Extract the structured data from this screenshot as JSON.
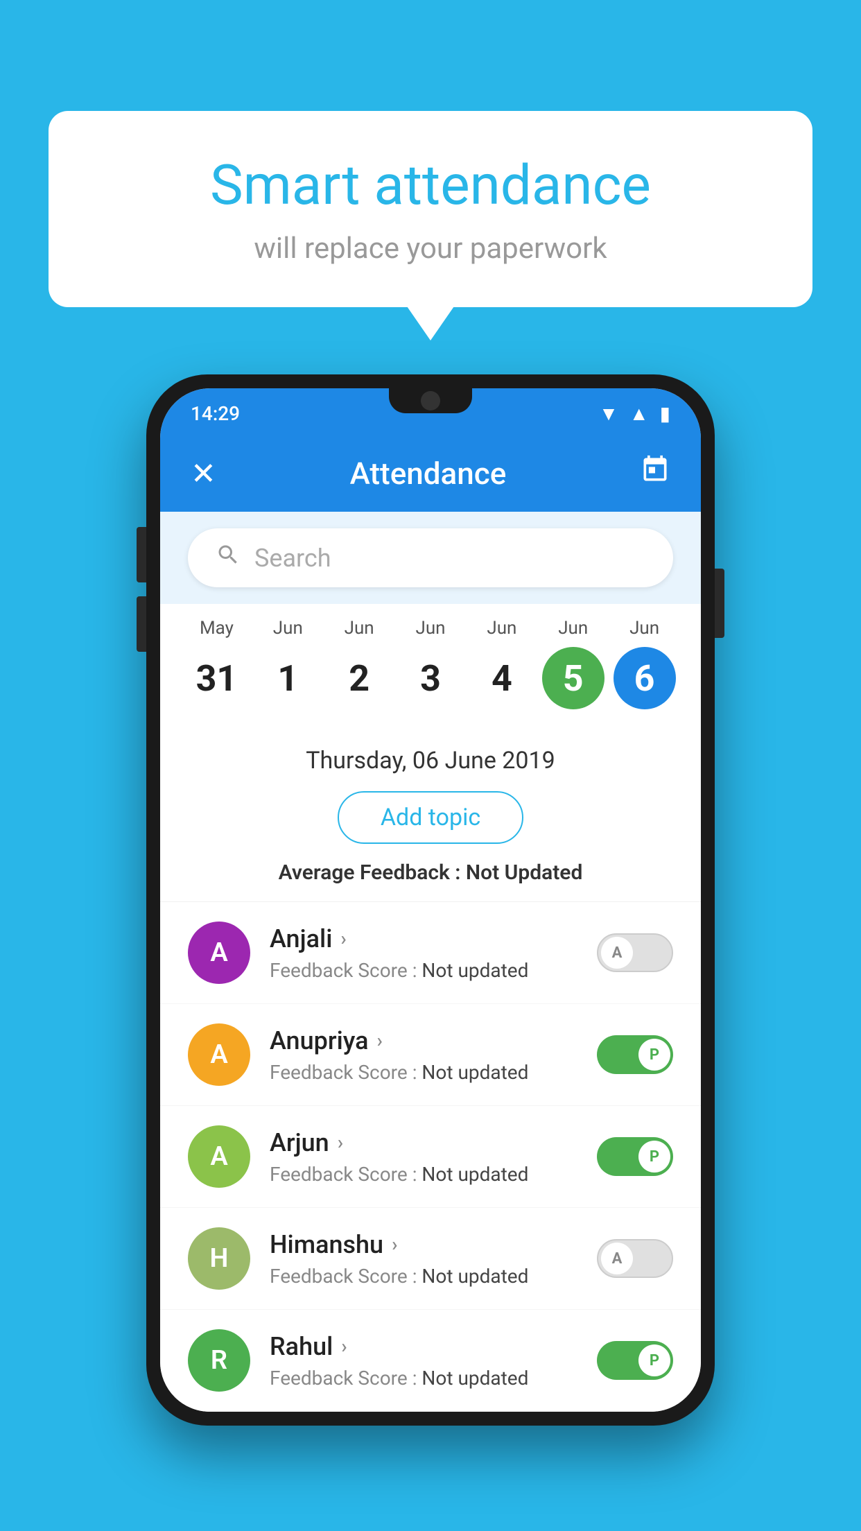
{
  "background_color": "#29b6e8",
  "speech_bubble": {
    "title": "Smart attendance",
    "subtitle": "will replace your paperwork"
  },
  "status_bar": {
    "time": "14:29",
    "icons": [
      "wifi",
      "signal",
      "battery"
    ]
  },
  "app_bar": {
    "title": "Attendance",
    "close_label": "✕",
    "calendar_icon": "📅"
  },
  "search": {
    "placeholder": "Search"
  },
  "calendar": {
    "days": [
      {
        "month": "May",
        "date": "31",
        "style": "normal"
      },
      {
        "month": "Jun",
        "date": "1",
        "style": "normal"
      },
      {
        "month": "Jun",
        "date": "2",
        "style": "normal"
      },
      {
        "month": "Jun",
        "date": "3",
        "style": "normal"
      },
      {
        "month": "Jun",
        "date": "4",
        "style": "normal"
      },
      {
        "month": "Jun",
        "date": "5",
        "style": "today"
      },
      {
        "month": "Jun",
        "date": "6",
        "style": "selected"
      }
    ]
  },
  "date_info": {
    "label": "Thursday, 06 June 2019",
    "add_topic_label": "Add topic",
    "avg_feedback_label": "Average Feedback : ",
    "avg_feedback_value": "Not Updated"
  },
  "students": [
    {
      "name": "Anjali",
      "avatar_letter": "A",
      "avatar_color": "#9c27b0",
      "feedback_label": "Feedback Score : ",
      "feedback_value": "Not updated",
      "toggle_state": "off",
      "toggle_label": "A"
    },
    {
      "name": "Anupriya",
      "avatar_letter": "A",
      "avatar_color": "#f5a623",
      "feedback_label": "Feedback Score : ",
      "feedback_value": "Not updated",
      "toggle_state": "on",
      "toggle_label": "P"
    },
    {
      "name": "Arjun",
      "avatar_letter": "A",
      "avatar_color": "#8bc34a",
      "feedback_label": "Feedback Score : ",
      "feedback_value": "Not updated",
      "toggle_state": "on",
      "toggle_label": "P"
    },
    {
      "name": "Himanshu",
      "avatar_letter": "H",
      "avatar_color": "#9cba6a",
      "feedback_label": "Feedback Score : ",
      "feedback_value": "Not updated",
      "toggle_state": "off",
      "toggle_label": "A"
    },
    {
      "name": "Rahul",
      "avatar_letter": "R",
      "avatar_color": "#4caf50",
      "feedback_label": "Feedback Score : ",
      "feedback_value": "Not updated",
      "toggle_state": "on",
      "toggle_label": "P"
    }
  ]
}
